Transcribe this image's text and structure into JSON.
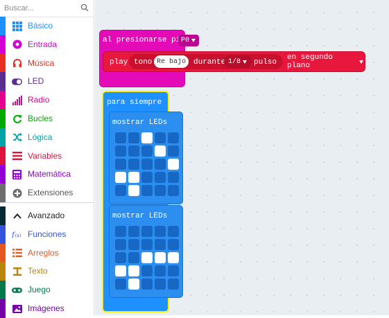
{
  "search": {
    "placeholder": "Buscar..."
  },
  "toolbox": {
    "categories": [
      {
        "label": "Básico",
        "color": "#1e90ff",
        "icon": "grid-icon"
      },
      {
        "label": "Entrada",
        "color": "#d400d4",
        "icon": "radio-button-icon"
      },
      {
        "label": "Música",
        "color": "#e63022",
        "icon": "headphones-icon"
      },
      {
        "label": "LED",
        "color": "#5c2d91",
        "icon": "toggle-icon"
      },
      {
        "label": "Radio",
        "color": "#e3008c",
        "icon": "signal-bars-icon"
      },
      {
        "label": "Bucles",
        "color": "#00aa00",
        "icon": "refresh-icon"
      },
      {
        "label": "Lógica",
        "color": "#00a4a6",
        "icon": "shuffle-icon"
      },
      {
        "label": "Variables",
        "color": "#dc143c",
        "icon": "list-lines-icon"
      },
      {
        "label": "Matemática",
        "color": "#9400d3",
        "icon": "calculator-icon"
      },
      {
        "label": "Extensiones",
        "color": "#6d6d6d",
        "icon": "plus-circle-icon"
      }
    ],
    "advanced": [
      {
        "label": "Avanzado",
        "color": "#062a33",
        "icon": "chevron-up-icon"
      },
      {
        "label": "Funciones",
        "color": "#3455db",
        "icon": "function-icon"
      },
      {
        "label": "Arreglos",
        "color": "#e65722",
        "icon": "array-icon"
      },
      {
        "label": "Texto",
        "color": "#b8860b",
        "icon": "text-icon"
      },
      {
        "label": "Juego",
        "color": "#007a4b",
        "icon": "gamepad-icon"
      },
      {
        "label": "Imágenes",
        "color": "#7600a8",
        "icon": "image-icon"
      }
    ]
  },
  "blocks": {
    "on_press": {
      "label": "al presionarse pin",
      "pin": "P0"
    },
    "play": {
      "play_label": "play",
      "tono_label": "tono",
      "note": "Re bajo",
      "durante_label": "durante",
      "beat": "1/8",
      "pulso_label": "pulso",
      "mode": "en segundo plano"
    },
    "forever": {
      "label": "para siempre"
    },
    "show_leds": [
      {
        "label": "mostrar LEDs",
        "leds": [
          [
            0,
            0,
            1,
            0,
            0
          ],
          [
            0,
            0,
            0,
            1,
            0
          ],
          [
            0,
            0,
            0,
            0,
            1
          ],
          [
            1,
            1,
            0,
            0,
            0
          ],
          [
            0,
            1,
            0,
            0,
            0
          ]
        ]
      },
      {
        "label": "mostrar LEDs",
        "leds": [
          [
            0,
            0,
            0,
            0,
            0
          ],
          [
            0,
            0,
            0,
            0,
            0
          ],
          [
            0,
            0,
            1,
            1,
            1
          ],
          [
            1,
            1,
            0,
            0,
            0
          ],
          [
            0,
            1,
            0,
            0,
            0
          ]
        ]
      }
    ]
  },
  "colors": {
    "workspace": "#e9eef2",
    "music_block": "#e8173e",
    "input_block": "#e50ab8",
    "basic_block": "#1e90ff",
    "selection": "#f3f20c"
  }
}
